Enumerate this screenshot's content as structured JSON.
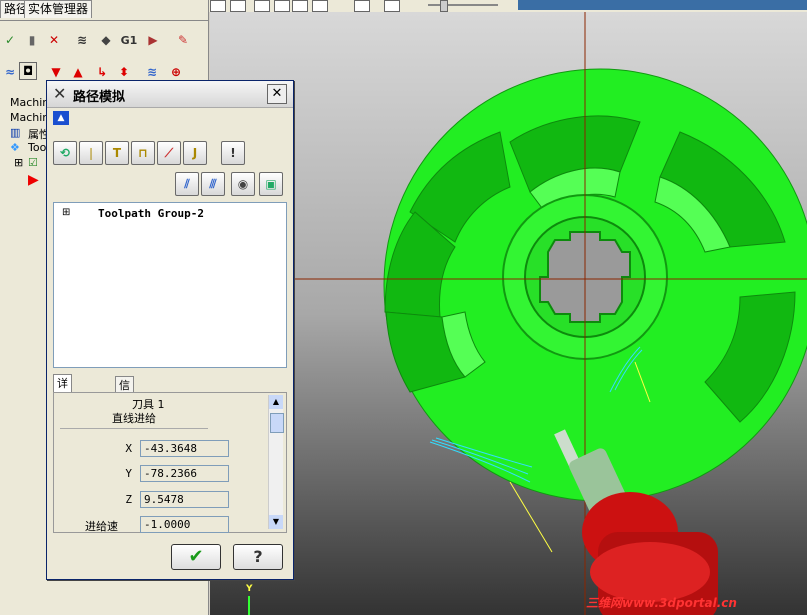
{
  "left_panel": {
    "tabs": [
      "路径",
      "实体管理器"
    ],
    "tree": [
      "Machin",
      "Machin",
      "属性",
      "Tool"
    ]
  },
  "toolbar": {
    "g1_label": "G1"
  },
  "dialog": {
    "title": "路径模拟",
    "tree_root": "Toolpath Group-2",
    "tabs": [
      "详细信息",
      "信息"
    ],
    "tool_label": "刀具 1",
    "move_label": "直线进给",
    "fields": [
      {
        "label": "X",
        "value": "-43.3648"
      },
      {
        "label": "Y",
        "value": "-78.2366"
      },
      {
        "label": "Z",
        "value": "9.5478"
      },
      {
        "label": "进给速",
        "value": "-1.0000"
      }
    ]
  },
  "viewport": {
    "axis_label": "Y",
    "watermark": "三维网www.3dportal.cn"
  },
  "colors": {
    "impeller": "#22ee22",
    "crosshair": "#8b2500",
    "spindle": "#cc1111",
    "toolpath": "#33ddff"
  }
}
